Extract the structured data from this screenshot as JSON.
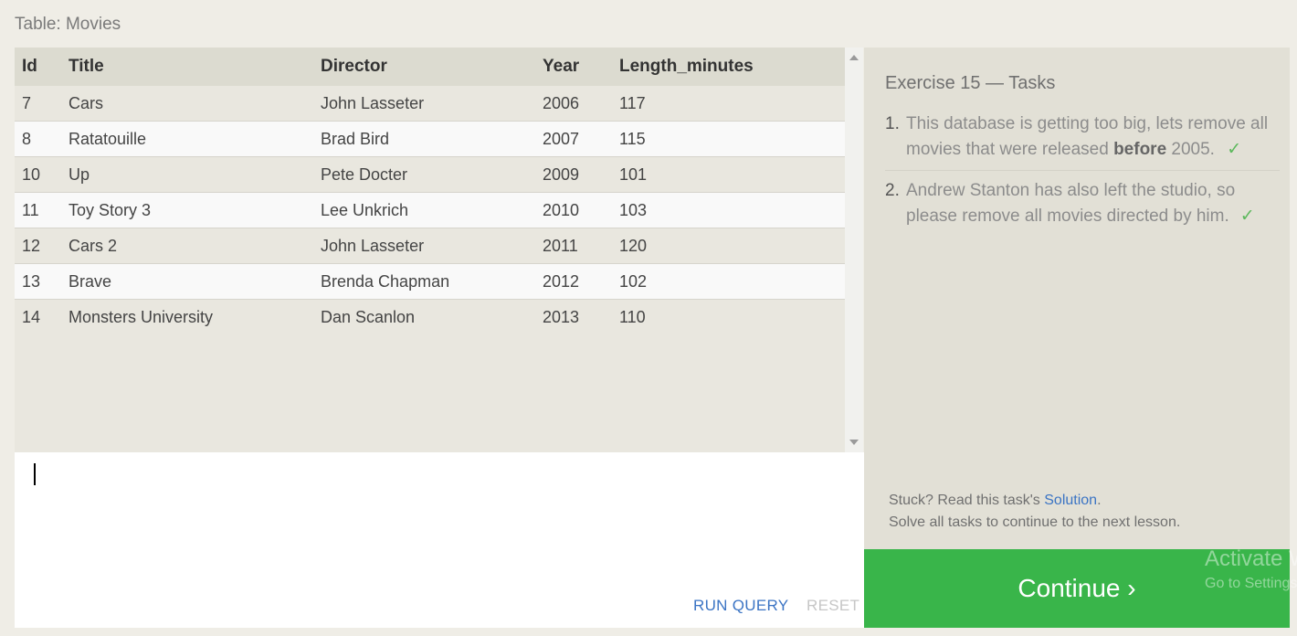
{
  "table": {
    "caption": "Table: Movies",
    "columns": [
      "Id",
      "Title",
      "Director",
      "Year",
      "Length_minutes"
    ],
    "rows": [
      [
        "7",
        "Cars",
        "John Lasseter",
        "2006",
        "117"
      ],
      [
        "8",
        "Ratatouille",
        "Brad Bird",
        "2007",
        "115"
      ],
      [
        "10",
        "Up",
        "Pete Docter",
        "2009",
        "101"
      ],
      [
        "11",
        "Toy Story 3",
        "Lee Unkrich",
        "2010",
        "103"
      ],
      [
        "12",
        "Cars 2",
        "John Lasseter",
        "2011",
        "120"
      ],
      [
        "13",
        "Brave",
        "Brenda Chapman",
        "2012",
        "102"
      ],
      [
        "14",
        "Monsters University",
        "Dan Scanlon",
        "2013",
        "110"
      ]
    ]
  },
  "editor": {
    "value": "",
    "run_label": "RUN QUERY",
    "reset_label": "RESET"
  },
  "tasks": {
    "title": "Exercise 15 — Tasks",
    "items": [
      {
        "num": "1.",
        "text_before": "This database is getting too big, lets remove all movies that were released ",
        "bold": "before",
        "text_after": " 2005.",
        "check": "✓"
      },
      {
        "num": "2.",
        "text_before": "Andrew Stanton has also left the studio, so please remove all movies directed by him.",
        "bold": "",
        "text_after": "",
        "check": "✓"
      }
    ],
    "hint_prefix": "Stuck? Read this task's ",
    "hint_link": "Solution",
    "hint_suffix": ".",
    "hint_line2": "Solve all tasks to continue to the next lesson."
  },
  "continue_label": "Continue ›",
  "watermark": {
    "line1": "Activate Windows",
    "line2": "Go to Settings to activate Windows."
  },
  "colors": {
    "continue_bg": "#39b54a",
    "link": "#3b74c4",
    "check": "#5cb85c"
  }
}
